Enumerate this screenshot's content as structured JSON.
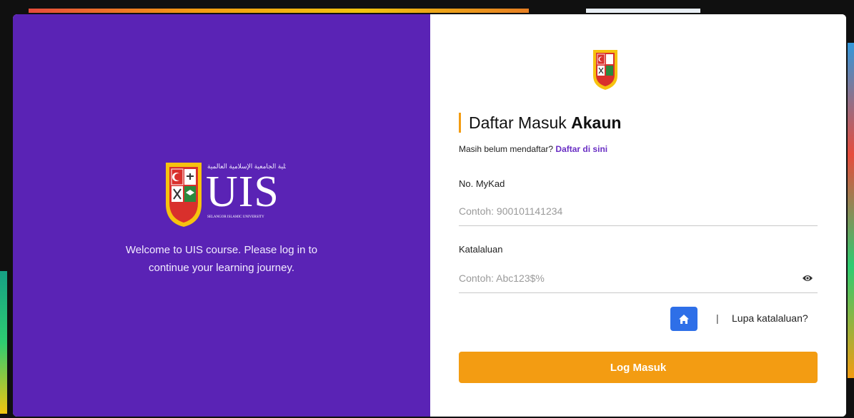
{
  "brand": {
    "wordmark": "UIS",
    "arabic_text": "الكلية الجامعية الإسلامية العالمية",
    "subtitle": "SELANGOR ISLAMIC UNIVERSITY",
    "colors": {
      "purple": "#5a23b5",
      "accent": "#f39c12",
      "red": "#d9302c",
      "green": "#2a8a3e",
      "yellow": "#f6c20f"
    }
  },
  "welcome": {
    "line1": "Welcome to UIS course. Please log in to",
    "line2": "continue your learning journey."
  },
  "form": {
    "heading_normal": "Daftar Masuk",
    "heading_bold": "Akaun",
    "register_prompt": "Masih belum mendaftar?",
    "register_link": "Daftar di sini",
    "mykad": {
      "label": "No. MyKad",
      "placeholder": "Contoh: 900101141234",
      "value": ""
    },
    "password": {
      "label": "Katalaluan",
      "placeholder": "Contoh: Abc123$%",
      "value": "",
      "toggle_icon": "eye-icon"
    },
    "home_icon": "home-icon",
    "separator": "|",
    "forgot": "Lupa katalaluan?",
    "submit": "Log Masuk"
  }
}
